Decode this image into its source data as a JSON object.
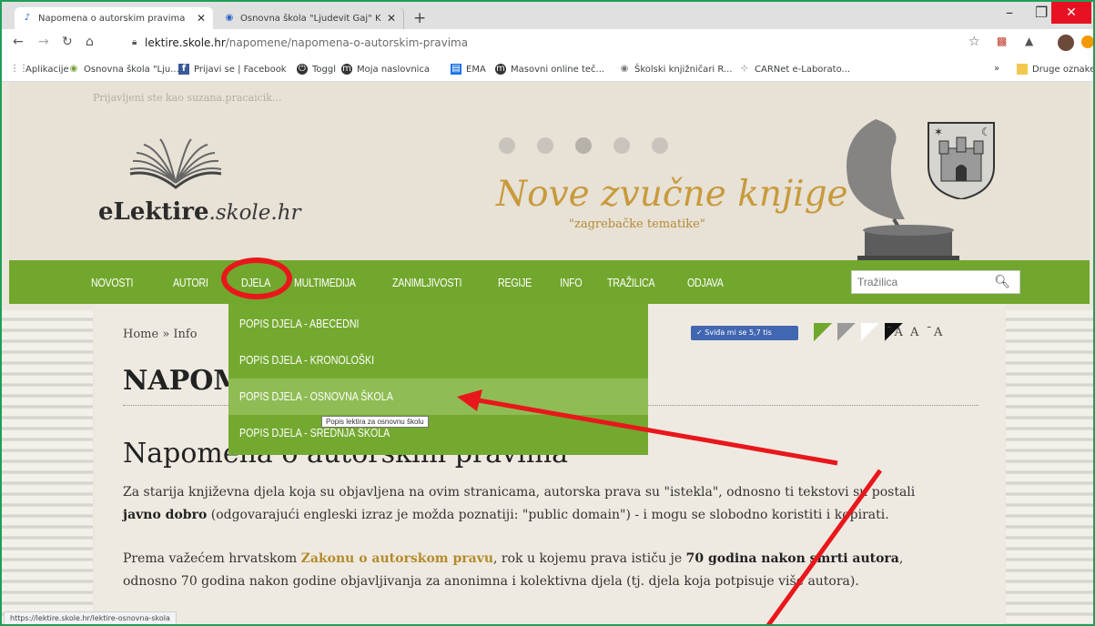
{
  "browser": {
    "tabs": [
      {
        "title": "Napomena o autorskim pravima",
        "favicon": "audio-favicon-icon",
        "active": true
      },
      {
        "title": "Osnovna škola \"Ljudevit Gaj\" Kr...",
        "favicon": "school-favicon-icon",
        "active": false
      }
    ],
    "new_tab_symbol": "+",
    "url_host": "lektire.skole.hr",
    "url_path": "/napomene/napomena-o-autorskim-pravima",
    "bookmarks": [
      {
        "label": "Aplikacije",
        "icon": "apps-grid-icon"
      },
      {
        "label": "Osnovna škola \"Lju...",
        "icon": "school-icon"
      },
      {
        "label": "Prijavi se | Facebook",
        "icon": "facebook-icon"
      },
      {
        "label": "Toggl",
        "icon": "toggl-icon"
      },
      {
        "label": "Moja naslovnica",
        "icon": "moodle-icon"
      },
      {
        "label": "EMA",
        "icon": "ema-icon"
      },
      {
        "label": "Masovni online teč...",
        "icon": "moodle-icon"
      },
      {
        "label": "Školski knjižničari R...",
        "icon": "library-icon"
      },
      {
        "label": "CARNet e-Laborato...",
        "icon": "carnet-icon"
      }
    ],
    "bookmarks_more": "»",
    "other_bookmarks": "Druge oznake",
    "status_url": "https://lektire.skole.hr/lektire-osnovna-skola",
    "accent_color": "#1f9e57"
  },
  "site": {
    "logged_in": "Prijavljeni ste kao suzana.pracaicik...",
    "logo_main": "eLektire",
    "logo_domain": ".skole.hr",
    "banner_title": "Nove zvučne knjige",
    "banner_subtitle": "\"zagrebačke tematike\"",
    "nav": [
      "NOVOSTI",
      "AUTORI",
      "DJELA",
      "MULTIMEDIJA",
      "ZANIMLJIVOSTI",
      "REGIJE",
      "INFO",
      "TRAŽILICA",
      "ODJAVA"
    ],
    "search_placeholder": "Tražilica",
    "nav_color": "#72a72e",
    "link_color": "#b48a2c"
  },
  "dropdown": {
    "items": [
      "POPIS DJELA - ABECEDNI",
      "POPIS DJELA - KRONOLOŠKI",
      "POPIS DJELA - OSNOVNA ŠKOLA",
      "POPIS DJELA - SREDNJA ŠKOLA"
    ],
    "highlighted_index": 2,
    "tooltip": "Popis lektira za osnovnu školu"
  },
  "content": {
    "breadcrumb": "Home » Info",
    "heading": "NAPOMENA",
    "like_label": "Sviđa mi se 5,7 tis",
    "font_size_controls": "ˉA A ˉA",
    "title": "Napomena o autorskim pravima",
    "para1": {
      "a": "Za starija književna djela koja su objavljena na ovim stranicama, autorska prava su \"istekla\", odnosno ti tekstovi su postali",
      "b_bold": "javno dobro",
      "c": " (odgovarajući engleski izraz je možda poznatiji: \"public domain\") - i mogu se slobodno koristiti i kopirati."
    },
    "para2": {
      "a": "Prema važećem hrvatskom ",
      "link": "Zakonu o autorskom pravu",
      "b": ", rok u kojemu prava ističu je ",
      "c_bold": "70 godina nakon smrti autora",
      "d": ",",
      "e": "odnosno 70 godina nakon godine objavljivanja za anonimna i kolektivna djela (tj. djela koja potpisuje više autora)."
    }
  },
  "annotation_color": "#e8171b"
}
